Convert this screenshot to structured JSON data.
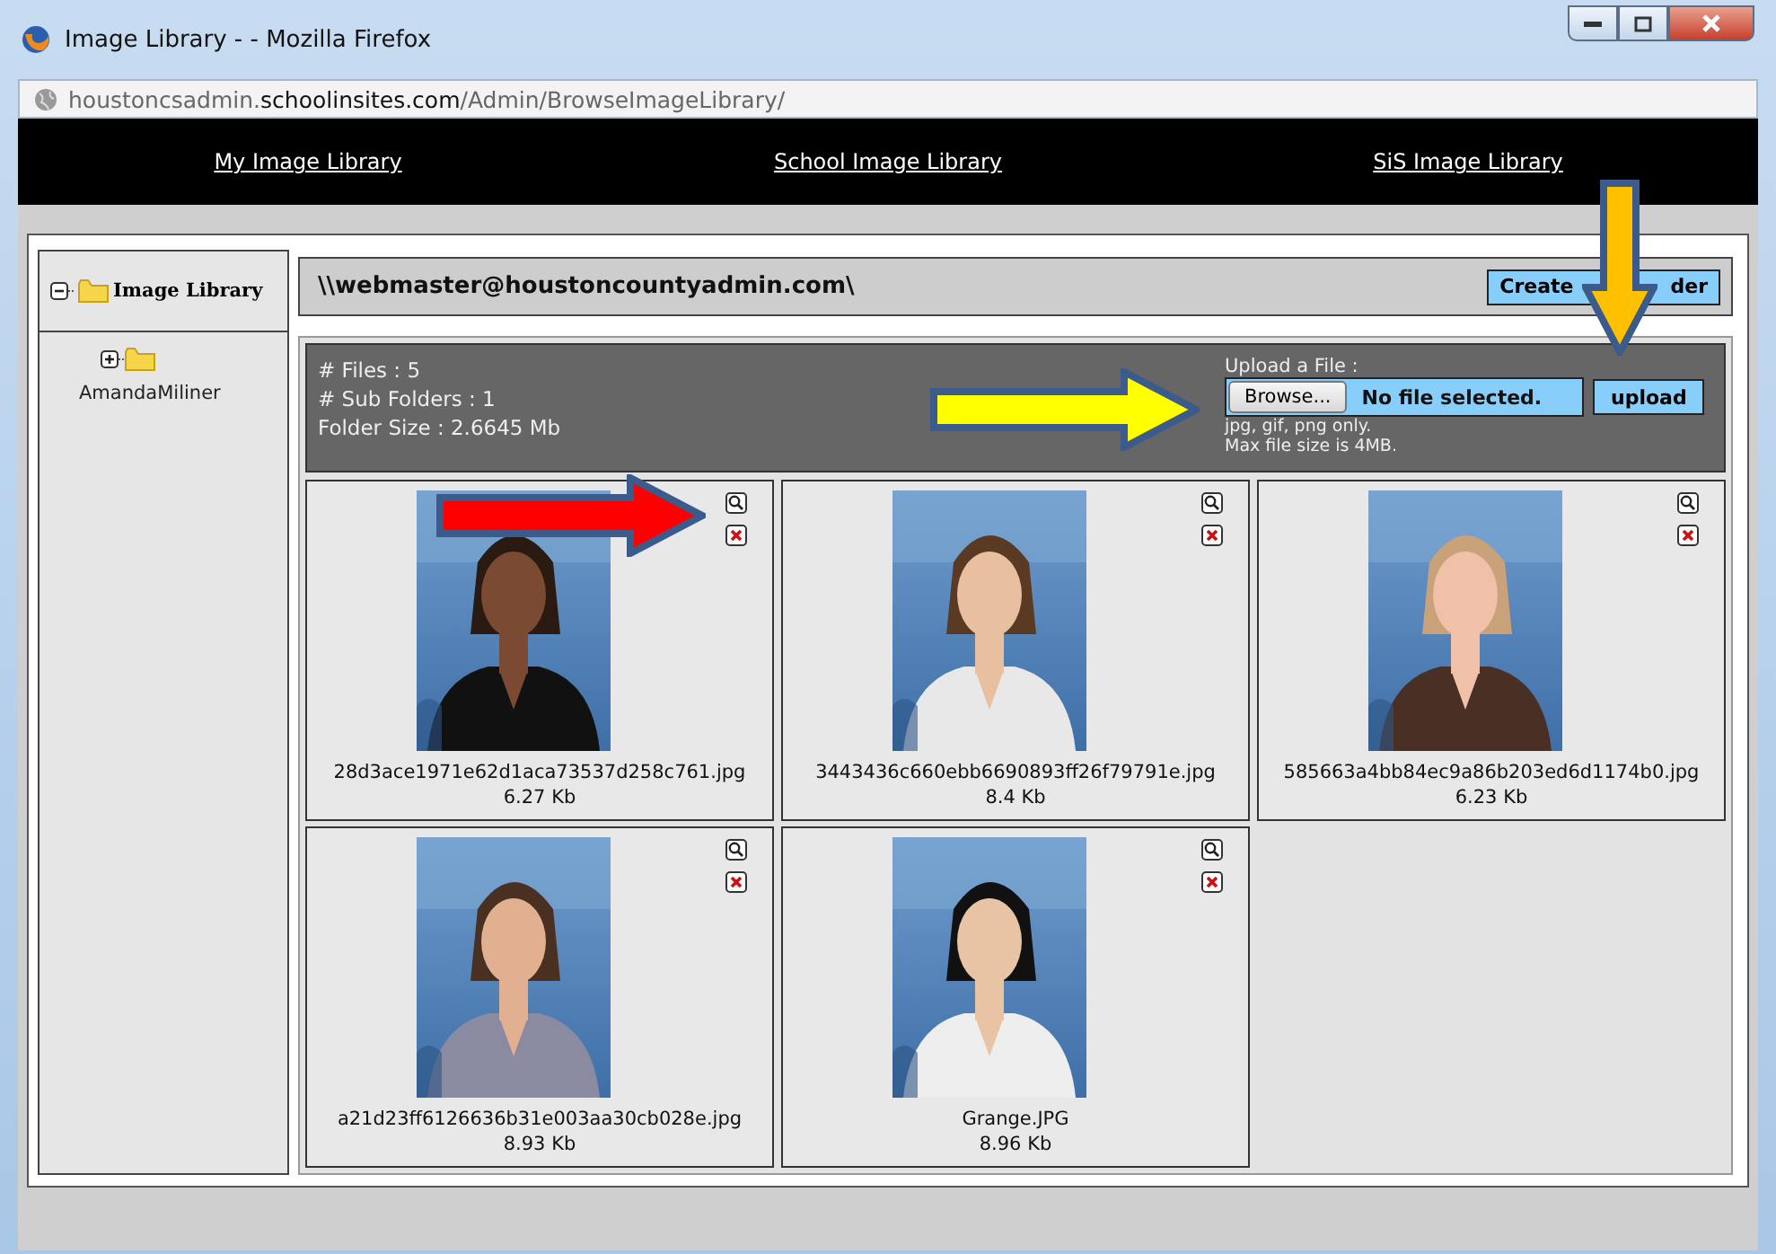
{
  "window": {
    "title": "Image Library - - Mozilla Firefox"
  },
  "address_bar": {
    "url": "houstoncsadmin.**schoolinsites.com**/Admin/BrowseImageLibrary/"
  },
  "nav": [
    {
      "label": "My Image Library"
    },
    {
      "label": "School Image Library"
    },
    {
      "label": "SiS Image Library"
    }
  ],
  "tree": {
    "label": "Image Library",
    "expanded": true,
    "children": [
      {
        "label": "AmandaMiliner",
        "expanded": false
      }
    ]
  },
  "path": "\\\\webmaster@houstoncountyadmin.com\\",
  "create_folder_button": {
    "visible_parts": [
      "Create",
      "der"
    ]
  },
  "stats": [
    "# Files : 5",
    "# Sub Folders : 1",
    "Folder Size : 2.6645 Mb"
  ],
  "upload": {
    "label": "Upload a File :",
    "browse_button": "Browse...",
    "file_status": "No file selected.",
    "upload_button": "upload",
    "notes": [
      "jpg, gif, png only.",
      "Max file size is 4MB."
    ]
  },
  "images": [
    {
      "filename": "28d3ace1971e62d1aca73537d258c761.jpg",
      "size": "6.27 Kb",
      "kind": "picture"
    },
    {
      "filename": "3443436c660ebb6690893ff26f79791e.jpg",
      "size": "8.4 Kb",
      "kind": "picture"
    },
    {
      "filename": "585663a4bb84ec9a86b203ed6d1174b0.jpg",
      "size": "6.23 Kb",
      "kind": "picture"
    },
    {
      "filename": "a21d23ff6126636b31e003aa30cb028e.jpg",
      "size": "8.93 Kb",
      "kind": "picture"
    },
    {
      "filename": "Grange.JPG",
      "size": "8.96 Kb",
      "kind": "picture"
    }
  ],
  "annotations": [
    {
      "kind": "arrow-down",
      "color": "#ffc000"
    },
    {
      "kind": "arrow-right",
      "color": "#ffff00"
    },
    {
      "kind": "arrow-right",
      "color": "#ff0000"
    }
  ]
}
